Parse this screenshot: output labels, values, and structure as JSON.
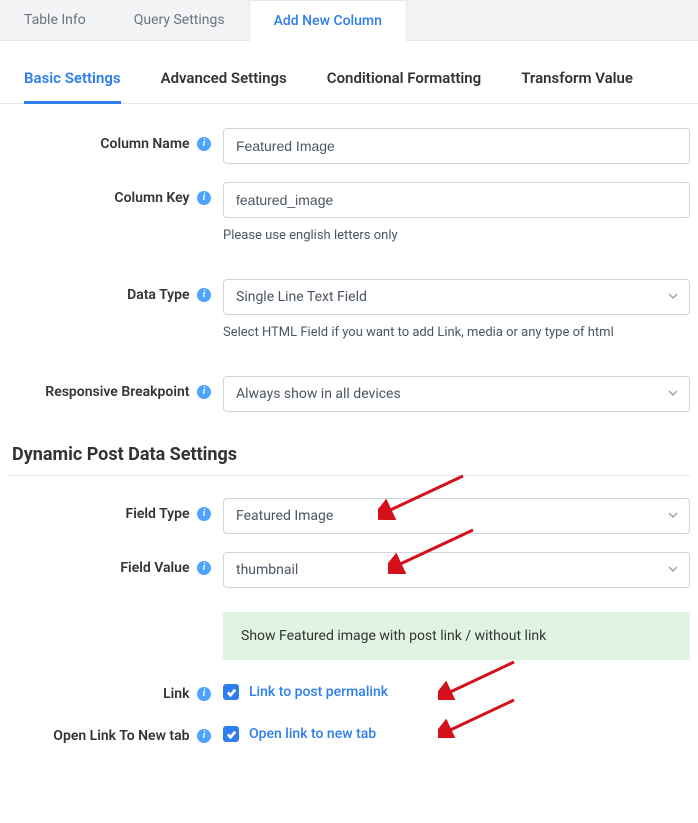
{
  "topTabs": {
    "tableInfo": "Table Info",
    "querySettings": "Query Settings",
    "addNewColumn": "Add New Column"
  },
  "subTabs": {
    "basic": "Basic Settings",
    "advanced": "Advanced Settings",
    "conditional": "Conditional Formatting",
    "transform": "Transform Value"
  },
  "columnName": {
    "label": "Column Name",
    "value": "Featured Image"
  },
  "columnKey": {
    "label": "Column Key",
    "value": "featured_image",
    "help": "Please use english letters only"
  },
  "dataType": {
    "label": "Data Type",
    "value": "Single Line Text Field",
    "help": "Select HTML Field if you want to add Link, media or any type of html"
  },
  "responsive": {
    "label": "Responsive Breakpoint",
    "value": "Always show in all devices"
  },
  "section2": {
    "title": "Dynamic Post Data Settings"
  },
  "fieldType": {
    "label": "Field Type",
    "value": "Featured Image"
  },
  "fieldValue": {
    "label": "Field Value",
    "value": "thumbnail"
  },
  "notice": "Show Featured image with post link / without link",
  "link": {
    "label": "Link",
    "checkLabel": "Link to post permalink",
    "checked": true
  },
  "newTab": {
    "label": "Open Link To New tab",
    "checkLabel": "Open link to new tab",
    "checked": true
  }
}
